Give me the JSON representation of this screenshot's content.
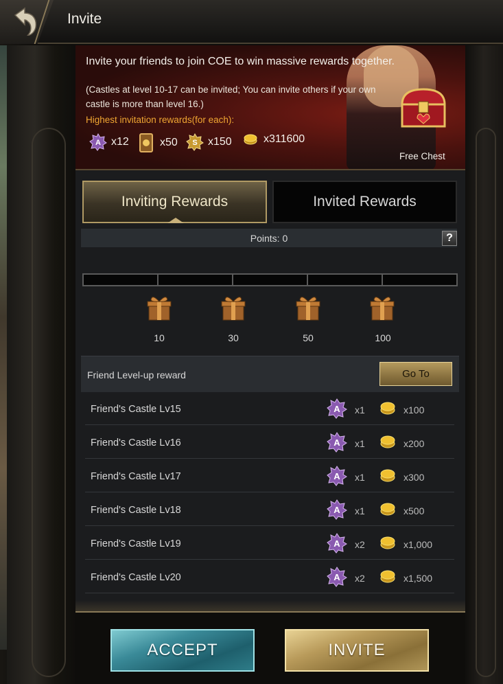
{
  "header": {
    "title": "Invite",
    "back_icon": "back-arrow-icon"
  },
  "banner": {
    "main_text": "Invite your friends to join COE to win massive rewards together.",
    "note_text": "(Castles at level 10-17 can be invited; You can invite others if your own castle is more than level 16.)",
    "highest_label": "Highest invitation rewards(for each):",
    "rewards": [
      {
        "icon": "a-gem-icon",
        "count": "x12"
      },
      {
        "icon": "card-icon",
        "count": "x50"
      },
      {
        "icon": "s-gem-icon",
        "count": "x150"
      },
      {
        "icon": "gold-coin-icon",
        "count": "x311600"
      }
    ],
    "chest_label": "Free Chest"
  },
  "tabs": [
    {
      "label": "Inviting Rewards",
      "active": true
    },
    {
      "label": "Invited Rewards",
      "active": false
    }
  ],
  "points": {
    "label": "Points: 0",
    "help": "?"
  },
  "milestones": [
    "10",
    "30",
    "50",
    "100"
  ],
  "levelup": {
    "label": "Friend Level-up reward",
    "button": "Go To"
  },
  "reward_rows": [
    {
      "name": "Friend's Castle Lv15",
      "a_count": "x1",
      "gold_count": "x100"
    },
    {
      "name": "Friend's Castle Lv16",
      "a_count": "x1",
      "gold_count": "x200"
    },
    {
      "name": "Friend's Castle Lv17",
      "a_count": "x1",
      "gold_count": "x300"
    },
    {
      "name": "Friend's Castle Lv18",
      "a_count": "x1",
      "gold_count": "x500"
    },
    {
      "name": "Friend's Castle Lv19",
      "a_count": "x2",
      "gold_count": "x1,000"
    },
    {
      "name": "Friend's Castle Lv20",
      "a_count": "x2",
      "gold_count": "x1,500"
    }
  ],
  "buttons": {
    "accept": "ACCEPT",
    "invite": "INVITE"
  },
  "colors": {
    "accent_orange": "#f0a632",
    "gold_button": "#b89a5a",
    "teal_button": "#3a8a98",
    "a_gem": "#8a5ab0"
  }
}
